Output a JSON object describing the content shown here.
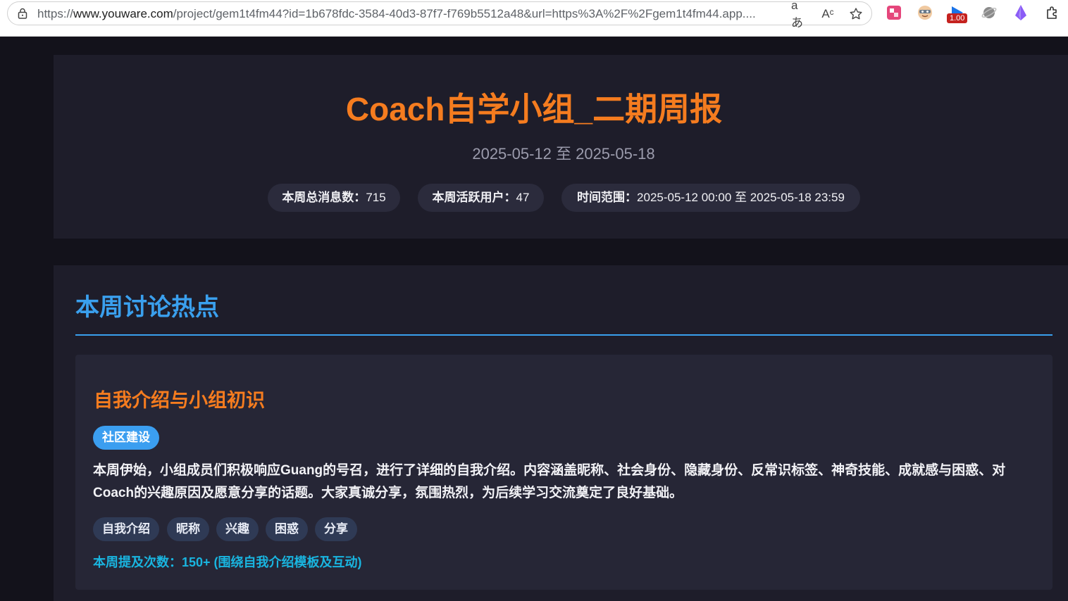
{
  "browser": {
    "url_scheme": "https://",
    "url_host": "www.youware.com",
    "url_rest": "/project/gem1t4fm44?id=1b678fdc-3584-40d3-87f7-f769b5512a48&url=https%3A%2F%2Fgem1t4fm44.app....",
    "read_aloud_icon": "Aᶜ",
    "translate_icon": "aあ",
    "extension_badge": "1.00"
  },
  "header": {
    "title": "Coach自学小组_二期周报",
    "date_range": "2025-05-12 至 2025-05-18",
    "stats": [
      {
        "label": "本周总消息数：",
        "value": "715"
      },
      {
        "label": "本周活跃用户：",
        "value": "47"
      },
      {
        "label": "时间范围：",
        "value": "2025-05-12 00:00 至 2025-05-18 23:59"
      }
    ]
  },
  "hot_topics": {
    "section_title": "本周讨论热点",
    "topics": [
      {
        "title": "自我介绍与小组初识",
        "category": "社区建设",
        "description": "本周伊始，小组成员们积极响应Guang的号召，进行了详细的自我介绍。内容涵盖昵称、社会身份、隐藏身份、反常识标签、神奇技能、成就感与困惑、对Coach的兴趣原因及愿意分享的话题。大家真诚分享，氛围热烈，为后续学习交流奠定了良好基础。",
        "keywords": [
          "自我介绍",
          "昵称",
          "兴趣",
          "困惑",
          "分享"
        ],
        "mentions": "本周提及次数：150+ (围绕自我介绍模板及互动)"
      }
    ]
  },
  "colors": {
    "accent_orange": "#f57c1f",
    "accent_blue": "#3aa0ee",
    "mention_cyan": "#19b5e0",
    "page_bg": "#13121b",
    "card_bg": "#1e1d2a"
  }
}
